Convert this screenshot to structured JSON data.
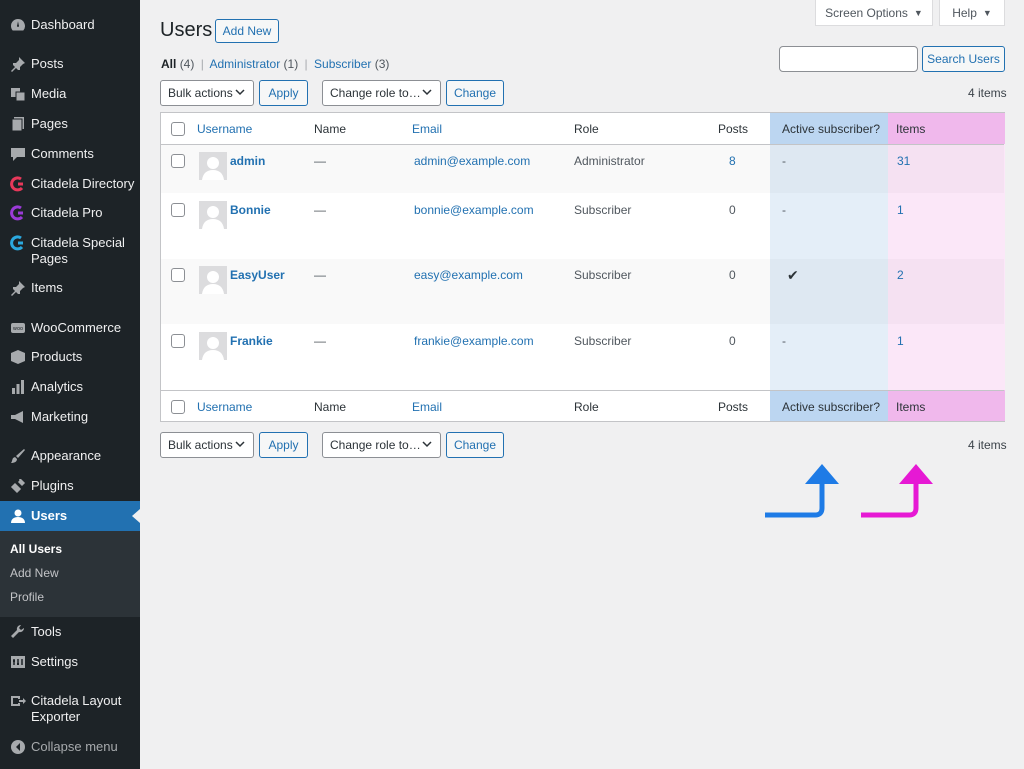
{
  "sidebar": {
    "items": [
      {
        "label": "Dashboard",
        "icon": "dashboard-icon"
      },
      {
        "label": "Posts",
        "icon": "pin-icon"
      },
      {
        "label": "Media",
        "icon": "media-icon"
      },
      {
        "label": "Pages",
        "icon": "pages-icon"
      },
      {
        "label": "Comments",
        "icon": "comment-icon"
      },
      {
        "label": "Citadela Directory",
        "icon": "citadela-icon"
      },
      {
        "label": "Citadela Pro",
        "icon": "citadela-icon"
      },
      {
        "label": "Citadela Special Pages",
        "icon": "citadela-icon"
      },
      {
        "label": "Items",
        "icon": "pin-icon"
      },
      {
        "label": "WooCommerce",
        "icon": "woo-icon"
      },
      {
        "label": "Products",
        "icon": "box-icon"
      },
      {
        "label": "Analytics",
        "icon": "bar-chart-icon"
      },
      {
        "label": "Marketing",
        "icon": "megaphone-icon"
      },
      {
        "label": "Appearance",
        "icon": "brush-icon"
      },
      {
        "label": "Plugins",
        "icon": "plug-icon"
      },
      {
        "label": "Users",
        "icon": "user-icon"
      },
      {
        "label": "Tools",
        "icon": "wrench-icon"
      },
      {
        "label": "Settings",
        "icon": "settings-icon"
      },
      {
        "label": "Citadela Layout Exporter",
        "icon": "export-icon"
      },
      {
        "label": "Collapse menu",
        "icon": "collapse-icon"
      }
    ],
    "submenu": [
      "All Users",
      "Add New",
      "Profile"
    ]
  },
  "topbar": {
    "screen_options": "Screen Options",
    "help": "Help"
  },
  "header": {
    "title": "Users",
    "add_new": "Add New"
  },
  "views": {
    "all": "All",
    "all_count": "(4)",
    "admin": "Administrator",
    "admin_count": "(1)",
    "subscriber": "Subscriber",
    "subscriber_count": "(3)",
    "sep": "|"
  },
  "search": {
    "button": "Search Users",
    "value": ""
  },
  "tablenav": {
    "bulk_actions": "Bulk actions",
    "apply": "Apply",
    "change_role": "Change role to…",
    "change": "Change",
    "items_count": "4 items"
  },
  "table": {
    "columns": {
      "username": "Username",
      "name": "Name",
      "email": "Email",
      "role": "Role",
      "posts": "Posts",
      "active_subscriber": "Active subscriber?",
      "items": "Items"
    },
    "rows": [
      {
        "username": "admin",
        "name": "—",
        "email": "admin@example.com",
        "role": "Administrator",
        "posts": "8",
        "active": "-",
        "items": "31"
      },
      {
        "username": "Bonnie",
        "name": "—",
        "email": "bonnie@example.com",
        "role": "Subscriber",
        "posts": "0",
        "active": "-",
        "items": "1"
      },
      {
        "username": "EasyUser",
        "name": "—",
        "email": "easy@example.com",
        "role": "Subscriber",
        "posts": "0",
        "active": "✔",
        "items": "2"
      },
      {
        "username": "Frankie",
        "name": "—",
        "email": "frankie@example.com",
        "role": "Subscriber",
        "posts": "0",
        "active": "-",
        "items": "1"
      }
    ]
  },
  "colors": {
    "sidebar_bg": "#1d2327",
    "accent": "#2271b1",
    "active_col": "#bcd6f1",
    "items_col": "#f0b8ec",
    "arrow_blue": "#1e7be6",
    "arrow_pink": "#e619d4"
  }
}
